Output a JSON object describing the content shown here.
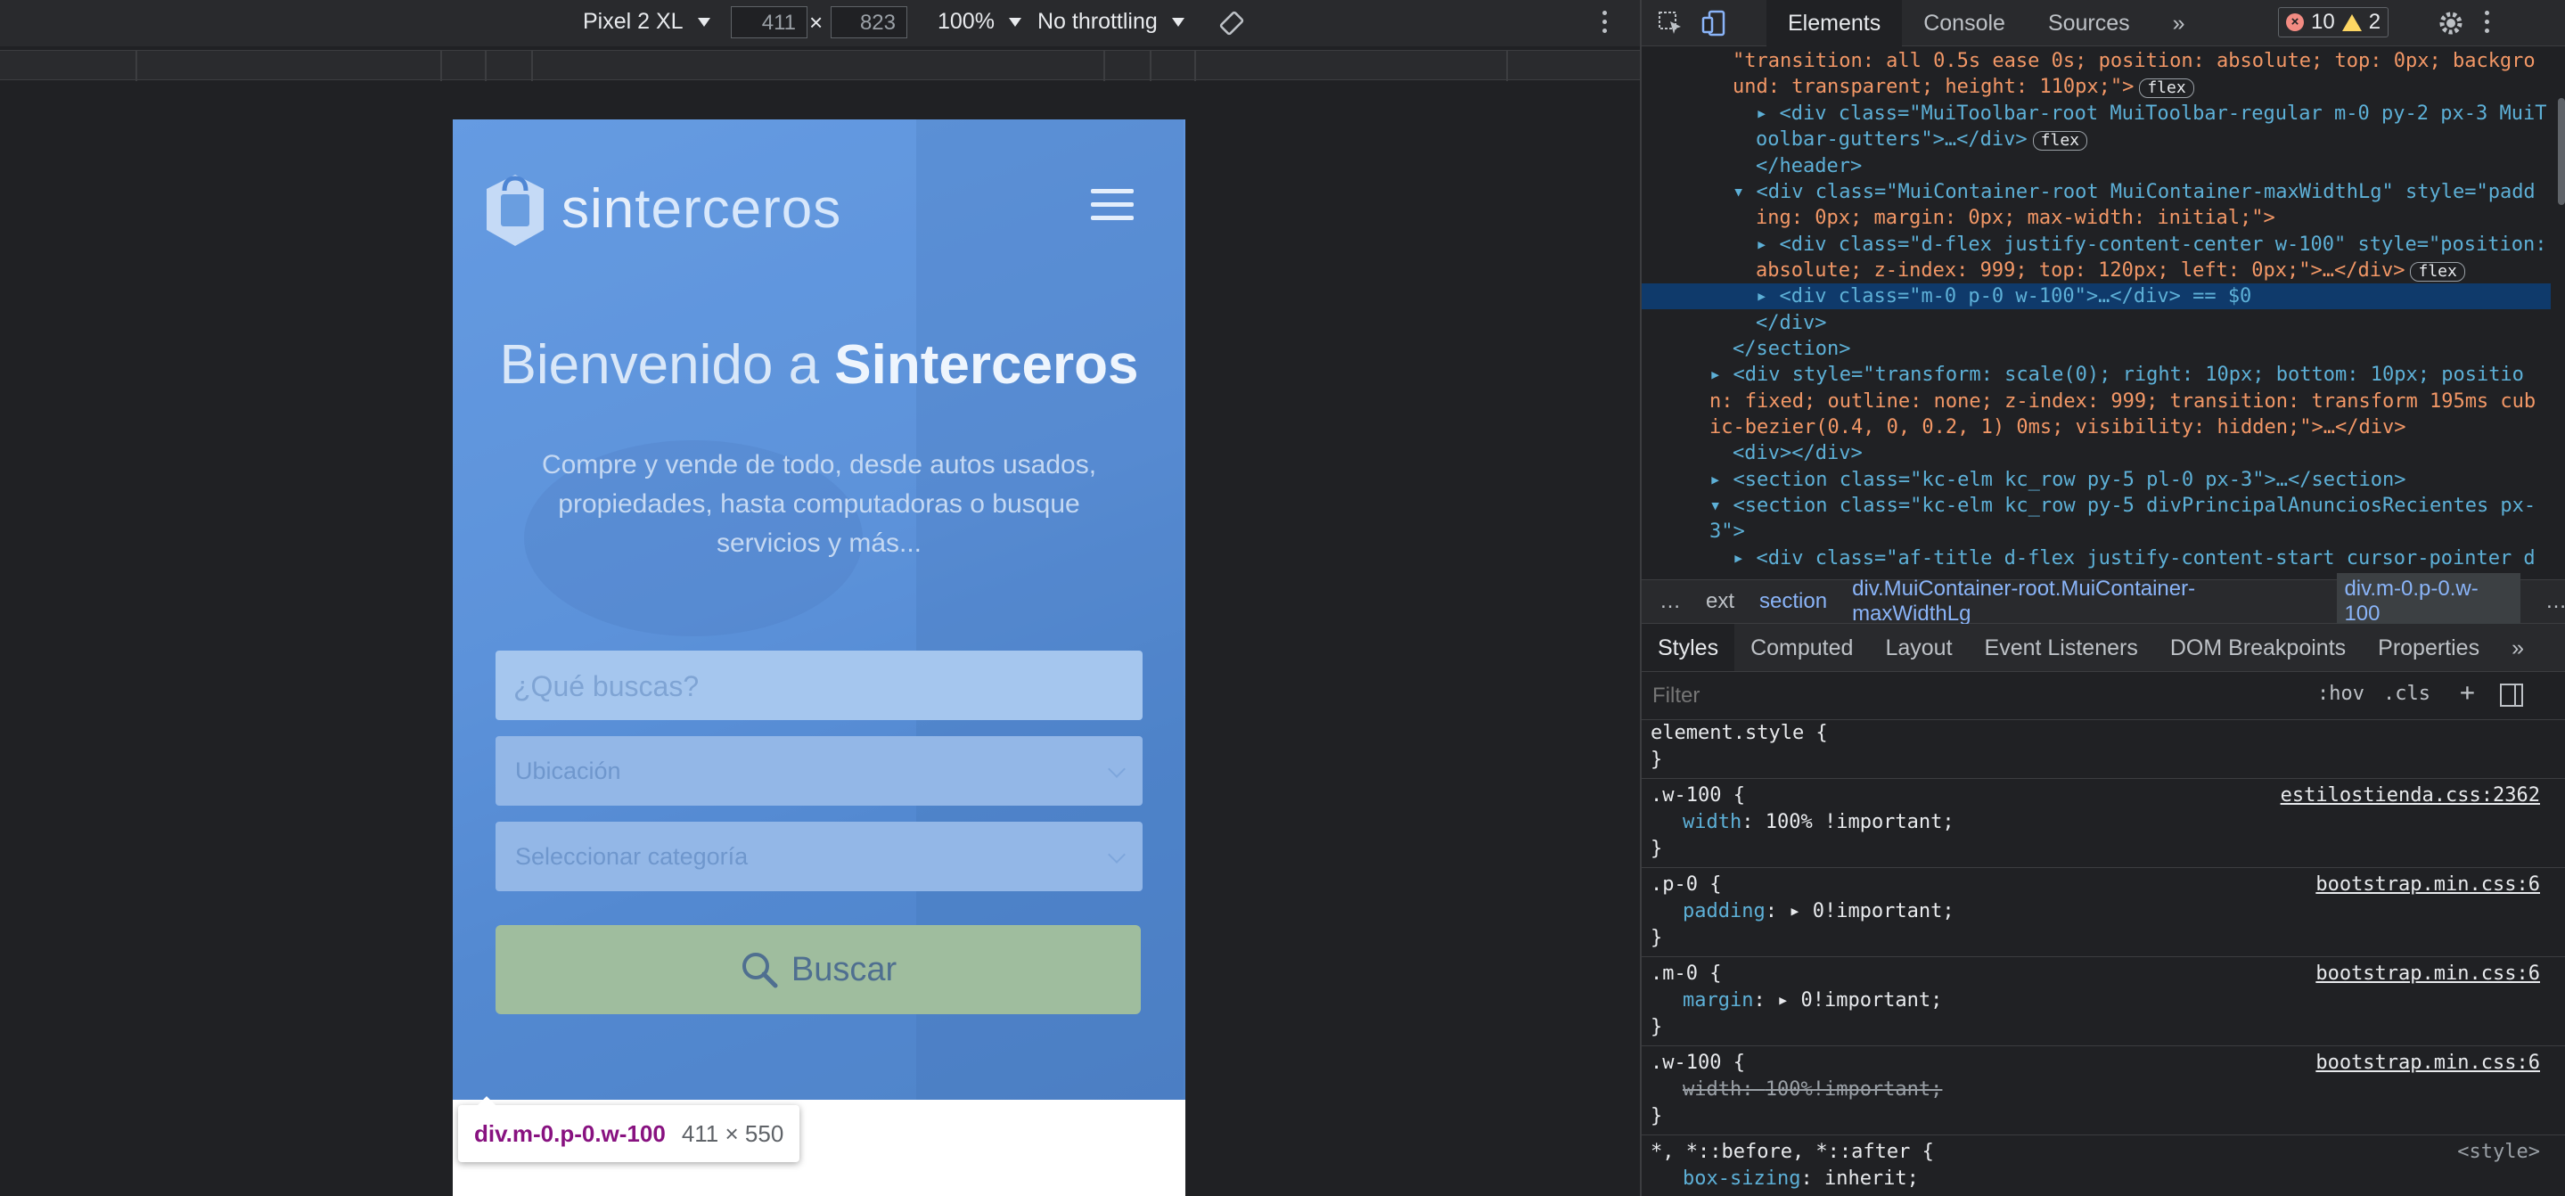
{
  "device_toolbar": {
    "device": "Pixel 2 XL",
    "width": "411",
    "height": "823",
    "zoom": "100%",
    "throttling": "No throttling"
  },
  "site": {
    "logo_prefix": "sin",
    "logo_suffix": "terceros",
    "welcome_light": "Bienvenido a",
    "welcome_bold": "Sinterceros",
    "subtitle": "Compre y vende de todo, desde autos usados, propiedades, hasta computadoras o busque servicios y más...",
    "search_placeholder": "¿Qué buscas?",
    "location_placeholder": "Ubicación",
    "category_placeholder": "Seleccionar categoría",
    "search_button": "Buscar"
  },
  "tooltip": {
    "selector": "div.m-0.p-0.w-100",
    "size": "411 × 550"
  },
  "devtools": {
    "tabs": [
      "Elements",
      "Console",
      "Sources"
    ],
    "more_tabs": "»",
    "errors": "10",
    "warnings": "2",
    "dom_lines": [
      "\"transition: all 0.5s ease 0s; position: absolute; top: 0px; backgro",
      "und: transparent; height: 110px;\">",
      "<div class=\"MuiToolbar-root MuiToolbar-regular m-0 py-2 px-3 MuiT",
      "oolbar-gutters\">…</div>",
      "</header>",
      "<div class=\"MuiContainer-root MuiContainer-maxWidthLg\" style=\"padd",
      "ing: 0px; margin: 0px; max-width: initial;\">",
      "<div class=\"d-flex justify-content-center w-100\" style=\"position:",
      "absolute; z-index: 999; top: 120px; left: 0px;\">…</div>",
      "<div class=\"m-0 p-0 w-100\">…</div> == $0",
      "</div>",
      "</section>",
      "<div style=\"transform: scale(0); right: 10px; bottom: 10px; positio",
      "n: fixed; outline: none; z-index: 999; transition: transform 195ms cub",
      "ic-bezier(0.4, 0, 0.2, 1) 0ms; visibility: hidden;\">…</div>",
      "<div></div>",
      "<section class=\"kc-elm kc_row py-5 pl-0 px-3\">…</section>",
      "<section class=\"kc-elm kc_row py-5 divPrincipalAnunciosRecientes px-",
      "3\">",
      "<div class=\"af-title d-flex justify-content-start cursor-pointer d"
    ],
    "flex_badge": "flex",
    "breadcrumbs": [
      "…",
      "ext",
      "section",
      "div.MuiContainer-root.MuiContainer-maxWidthLg",
      "div.m-0.p-0.w-100",
      "…"
    ],
    "sub_tabs": [
      "Styles",
      "Computed",
      "Layout",
      "Event Listeners",
      "DOM Breakpoints",
      "Properties"
    ],
    "filter_placeholder": "Filter",
    "hov": ":hov",
    "cls": ".cls",
    "rules": [
      {
        "selector": "element.style {",
        "props": [],
        "source": ""
      },
      {
        "selector": ".w-100 {",
        "props": [
          {
            "name": "width",
            "value": "100% !important;"
          }
        ],
        "source": "estilostienda.css:2362"
      },
      {
        "selector": ".p-0 {",
        "props": [
          {
            "name": "padding",
            "value": "0!important;"
          }
        ],
        "source": "bootstrap.min.css:6"
      },
      {
        "selector": ".m-0 {",
        "props": [
          {
            "name": "margin",
            "value": "0!important;"
          }
        ],
        "source": "bootstrap.min.css:6"
      },
      {
        "selector": ".w-100 {",
        "props": [
          {
            "name": "width",
            "value": "100%!important;"
          }
        ],
        "source": "bootstrap.min.css:6"
      },
      {
        "selector": "*, *::before, *::after {",
        "props": [
          {
            "name": "box-sizing",
            "value": "inherit;"
          }
        ],
        "source": "<style>"
      }
    ]
  }
}
